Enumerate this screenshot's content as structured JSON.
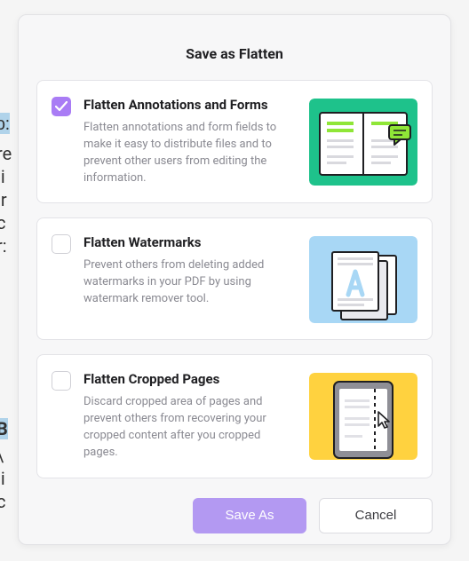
{
  "dialog": {
    "title": "Save as Flatten",
    "options": [
      {
        "checked": true,
        "title": "Flatten Annotations and Forms",
        "desc": "Flatten annotations and form fields to make it easy to distribute files and to prevent other users from editing the information."
      },
      {
        "checked": false,
        "title": "Flatten Watermarks",
        "desc": "Prevent others from deleting added watermarks in your PDF by using watermark remover tool."
      },
      {
        "checked": false,
        "title": "Flatten Cropped Pages",
        "desc": "Discard cropped area of pages and prevent others from recovering your cropped content after you cropped pages."
      }
    ],
    "buttons": {
      "primary": "Save As",
      "secondary": "Cancel"
    }
  }
}
